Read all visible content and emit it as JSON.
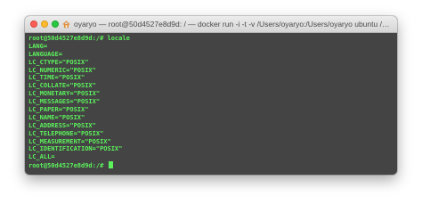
{
  "window": {
    "title": "oyaryo — root@50d4527e8d9d: / — docker run -i -t -v /Users/oyaryo:/Users/oyaryo ubuntu /b..."
  },
  "terminal": {
    "lines": [
      "root@50d4527e8d9d:/# locale",
      "LANG=",
      "LANGUAGE=",
      "LC_CTYPE=\"POSIX\"",
      "LC_NUMERIC=\"POSIX\"",
      "LC_TIME=\"POSIX\"",
      "LC_COLLATE=\"POSIX\"",
      "LC_MONETARY=\"POSIX\"",
      "LC_MESSAGES=\"POSIX\"",
      "LC_PAPER=\"POSIX\"",
      "LC_NAME=\"POSIX\"",
      "LC_ADDRESS=\"POSIX\"",
      "LC_TELEPHONE=\"POSIX\"",
      "LC_MEASUREMENT=\"POSIX\"",
      "LC_IDENTIFICATION=\"POSIX\"",
      "LC_ALL="
    ],
    "prompt": "root@50d4527e8d9d:/# "
  },
  "colors": {
    "terminal_bg": "#444444",
    "terminal_text": "#5cf25c",
    "close": "#fc5f57",
    "minimize": "#fdbc2e",
    "maximize": "#28c840"
  },
  "icons": {
    "title": "home-icon"
  }
}
